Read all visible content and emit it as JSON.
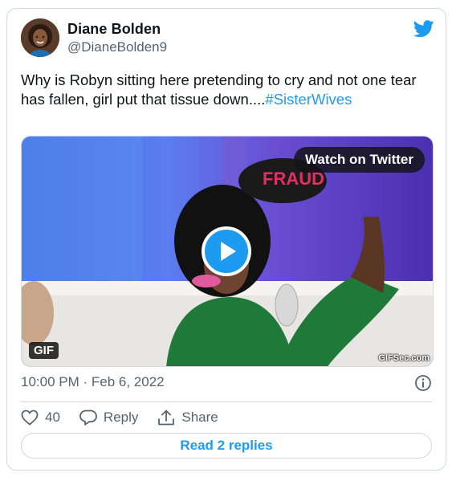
{
  "author": {
    "name": "Diane Bolden",
    "handle": "@DianeBolden9"
  },
  "tweet": {
    "text": "Why is Robyn sitting here pretending to cry and not one tear has fallen, girl put that tissue down....",
    "hashtag": "#SisterWives"
  },
  "media": {
    "watch_label": "Watch on Twitter",
    "gif_badge": "GIF",
    "sign_text": "FRAUD",
    "watermark": "GIFSec.com"
  },
  "meta": {
    "timestamp": "10:00 PM · Feb 6, 2022"
  },
  "actions": {
    "likes": "40",
    "reply_label": "Reply",
    "share_label": "Share",
    "read_replies": "Read 2 replies"
  },
  "colors": {
    "accent": "#1d9bf0",
    "text": "#0f1419",
    "secondary": "#536471",
    "border": "#cfd9de"
  }
}
